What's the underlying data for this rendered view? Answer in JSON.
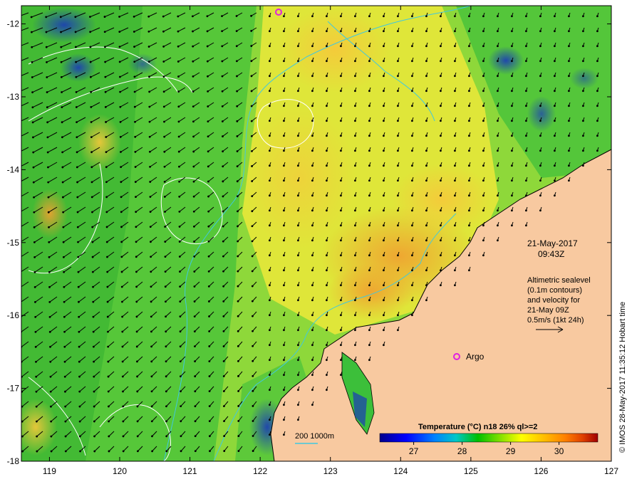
{
  "map": {
    "lon_ticks": [
      "119",
      "120",
      "121",
      "122",
      "123",
      "124",
      "125",
      "126",
      "127"
    ],
    "lat_ticks": [
      "-12",
      "-13",
      "-14",
      "-15",
      "-16",
      "-17",
      "-18"
    ],
    "lon_range": [
      118.6,
      127.0
    ],
    "lat_range": [
      -18.0,
      -11.75
    ],
    "land_color": "#f8c9a0",
    "ocean_colors": [
      "#1f8f2a",
      "#3cbf3a",
      "#8ed83a",
      "#e8e83a",
      "#f6c83a",
      "#f0a030"
    ]
  },
  "annotations": {
    "date": "21-May-2017",
    "time": "09:43Z",
    "altimetry_lines": [
      "Altimetric sealevel",
      "(0.1m contours)",
      "and velocity for",
      "21-May 09Z",
      "0.5m/s (1kt 24h)"
    ],
    "argo_label": "Argo",
    "bathy_label": "200  1000m",
    "credit": "© IMOS 28-May-2017 11:35:12 Hobart time"
  },
  "colorbar": {
    "title": "Temperature (°C) n18 26% ql>=2",
    "ticks": [
      "27",
      "28",
      "29",
      "30"
    ],
    "range": [
      26.3,
      30.8
    ],
    "colors": [
      "#00008b",
      "#0000ff",
      "#0080ff",
      "#00c8c8",
      "#00c000",
      "#80e000",
      "#ffff00",
      "#ffc000",
      "#ff8000",
      "#e04000",
      "#a00000"
    ]
  }
}
